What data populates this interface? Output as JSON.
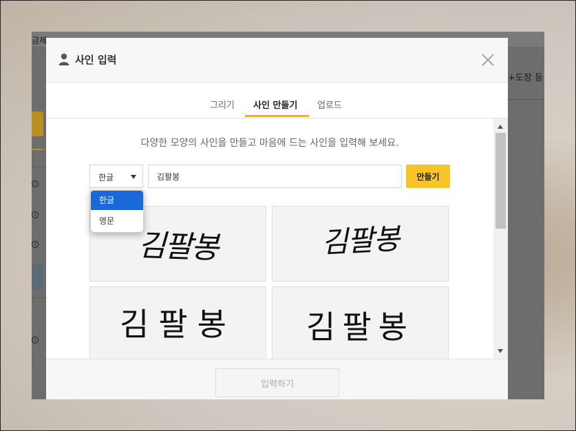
{
  "background_app": {
    "top_text": "금제 ",
    "right_text": "+도장 등"
  },
  "modal": {
    "title": "사인 입력",
    "tabs": [
      {
        "label": "그리기"
      },
      {
        "label": "사인 만들기"
      },
      {
        "label": "업로드"
      }
    ],
    "active_tab": "사인 만들기",
    "hint": "다양한 모양의 사인을 만들고 마음에 드는 사인을 입력해 보세요.",
    "language": {
      "selected": "한글",
      "options": [
        "한글",
        "영문"
      ]
    },
    "name_input": {
      "value": "김팔봉"
    },
    "make_button": "만들기",
    "signatures": [
      "김팔봉",
      "김팔봉",
      "김팔봉",
      "김팔봉"
    ],
    "submit_button": "입력하기"
  },
  "colors": {
    "accent": "#f7c527",
    "tab_underline": "#f4b400",
    "dropdown_selected": "#1a69d6"
  },
  "icons": {
    "header": "user-icon",
    "close": "close-icon"
  }
}
